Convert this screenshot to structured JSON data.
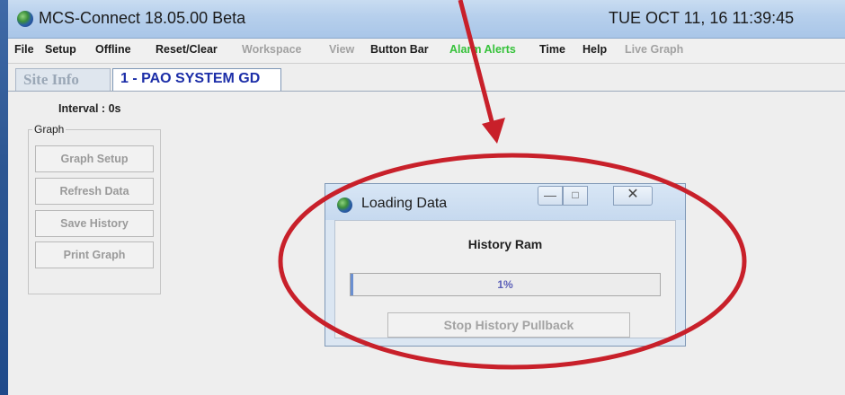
{
  "window": {
    "title": "MCS-Connect 18.05.00 Beta",
    "datetime": "TUE OCT 11, 16  11:39:45"
  },
  "menu": [
    {
      "label": "File",
      "state": "enabled"
    },
    {
      "label": "Setup",
      "state": "enabled"
    },
    {
      "label": "Offline",
      "state": "enabled"
    },
    {
      "label": "Reset/Clear",
      "state": "enabled"
    },
    {
      "label": "Workspace",
      "state": "disabled"
    },
    {
      "label": "View",
      "state": "disabled"
    },
    {
      "label": "Button Bar",
      "state": "enabled"
    },
    {
      "label": "Alarm Alerts",
      "state": "green"
    },
    {
      "label": "Time",
      "state": "enabled"
    },
    {
      "label": "Help",
      "state": "enabled"
    },
    {
      "label": "Live Graph",
      "state": "disabled"
    }
  ],
  "tabs": [
    {
      "label": "Site Info"
    },
    {
      "label": "1 - PAO SYSTEM GD"
    }
  ],
  "content": {
    "interval_label": "Interval : 0s",
    "graph_group_label": "Graph",
    "graph_buttons": [
      "Graph Setup",
      "Refresh Data",
      "Save History",
      "Print Graph"
    ]
  },
  "dialog": {
    "title": "Loading Data",
    "heading": "History Ram",
    "progress_percent": 1,
    "progress_text": "1%",
    "stop_button": "Stop History Pullback"
  },
  "colors": {
    "annotation": "#c8202a",
    "progress_fill": "#6a8fd0",
    "active_tab_text": "#1c2ea8",
    "menu_highlight": "#36c23a"
  }
}
